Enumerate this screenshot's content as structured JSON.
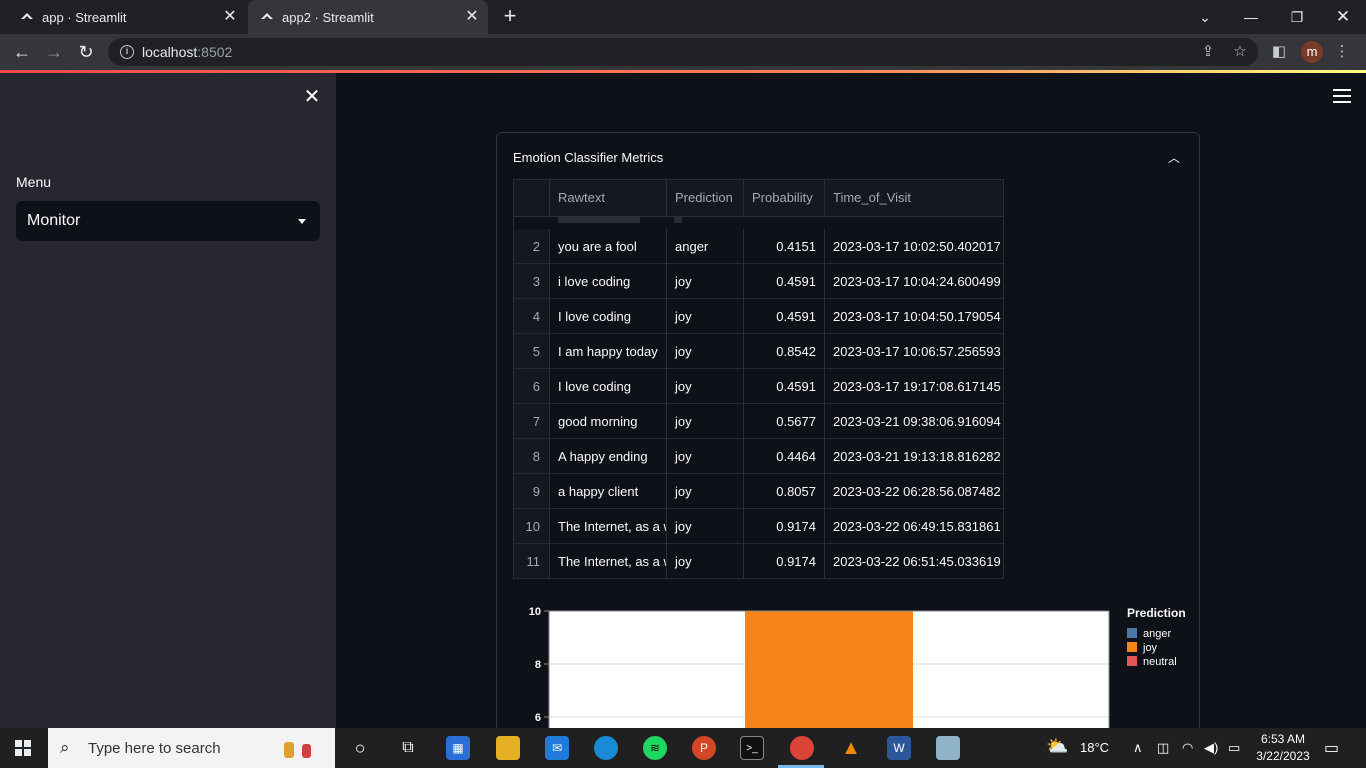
{
  "browser": {
    "tabs": [
      {
        "title": "app · Streamlit",
        "active": false
      },
      {
        "title": "app2 · Streamlit",
        "active": true
      }
    ],
    "url_host": "localhost",
    "url_port": ":8502",
    "profile_initial": "m"
  },
  "sidebar": {
    "menu_label": "Menu",
    "selected": "Monitor"
  },
  "expander": {
    "title": "Emotion Classifier Metrics"
  },
  "table": {
    "columns": [
      "Rawtext",
      "Prediction",
      "Probability",
      "Time_of_Visit"
    ],
    "rows": [
      {
        "idx": "2",
        "rawtext": "you are a fool",
        "prediction": "anger",
        "probability": "0.4151",
        "time": "2023-03-17 10:02:50.402017"
      },
      {
        "idx": "3",
        "rawtext": "i love coding",
        "prediction": "joy",
        "probability": "0.4591",
        "time": "2023-03-17 10:04:24.600499"
      },
      {
        "idx": "4",
        "rawtext": "I love coding",
        "prediction": "joy",
        "probability": "0.4591",
        "time": "2023-03-17 10:04:50.179054"
      },
      {
        "idx": "5",
        "rawtext": "I am happy today",
        "prediction": "joy",
        "probability": "0.8542",
        "time": "2023-03-17 10:06:57.256593"
      },
      {
        "idx": "6",
        "rawtext": "I love coding",
        "prediction": "joy",
        "probability": "0.4591",
        "time": "2023-03-17 19:17:08.617145"
      },
      {
        "idx": "7",
        "rawtext": "good morning",
        "prediction": "joy",
        "probability": "0.5677",
        "time": "2023-03-21 09:38:06.916094"
      },
      {
        "idx": "8",
        "rawtext": "A happy ending",
        "prediction": "joy",
        "probability": "0.4464",
        "time": "2023-03-21 19:13:18.816282"
      },
      {
        "idx": "9",
        "rawtext": " a happy client",
        "prediction": "joy",
        "probability": "0.8057",
        "time": "2023-03-22 06:28:56.087482"
      },
      {
        "idx": "10",
        "rawtext": "The Internet, as a w",
        "prediction": "joy",
        "probability": "0.9174",
        "time": "2023-03-22 06:49:15.831861"
      },
      {
        "idx": "11",
        "rawtext": "The Internet, as a w",
        "prediction": "joy",
        "probability": "0.9174",
        "time": "2023-03-22 06:51:45.033619"
      }
    ]
  },
  "chart_data": {
    "type": "bar",
    "y_ticks": [
      6,
      8,
      10
    ],
    "ylim_visible": [
      5.5,
      10
    ],
    "legend_title": "Prediction",
    "legend": [
      {
        "name": "anger",
        "color": "#4c78a8"
      },
      {
        "name": "joy",
        "color": "#f58518"
      },
      {
        "name": "neutral",
        "color": "#e45756"
      }
    ],
    "series": [
      {
        "name": "joy",
        "value": 10,
        "color": "#f58518"
      }
    ]
  },
  "taskbar": {
    "search_placeholder": "Type here to search",
    "weather": "18°C",
    "time": "6:53 AM",
    "date": "3/22/2023"
  }
}
